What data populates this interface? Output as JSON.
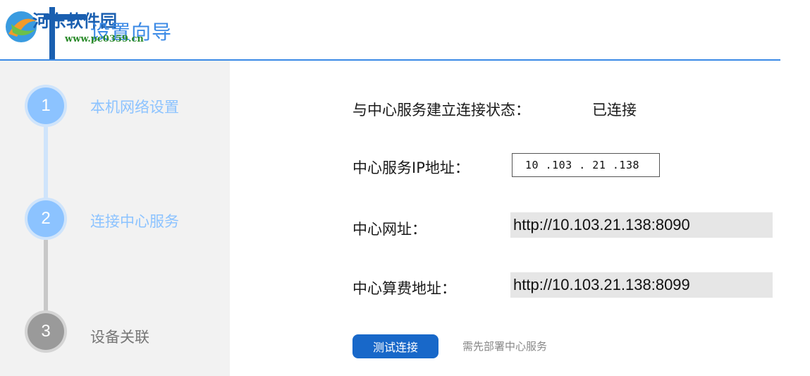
{
  "header": {
    "title": "设置向导",
    "watermark_text": "河东软件园",
    "watermark_url": "www.pc0359.cn"
  },
  "steps": [
    {
      "number": "1",
      "label": "本机网络设置",
      "state": "done",
      "color": "#8cc3ff"
    },
    {
      "number": "2",
      "label": "连接中心服务",
      "state": "active",
      "color": "#8cc3ff"
    },
    {
      "number": "3",
      "label": "设备关联",
      "state": "pending",
      "color": "#9a9a9a"
    }
  ],
  "form": {
    "status_label": "与中心服务建立连接状态：",
    "status_value": "已连接",
    "ip_label": "中心服务IP地址：",
    "ip_value": "10 .103 . 21 .138",
    "center_url_label": "中心网址：",
    "center_url_value": "http://10.103.21.138:8090",
    "billing_url_label": "中心算费地址：",
    "billing_url_value": "http://10.103.21.138:8099"
  },
  "actions": {
    "test_button_label": "测试连接",
    "hint": "需先部署中心服务"
  },
  "colors": {
    "accent": "#3b8ae6",
    "button": "#1868c9",
    "step_active": "#8cc3ff",
    "step_pending": "#9a9a9a"
  }
}
